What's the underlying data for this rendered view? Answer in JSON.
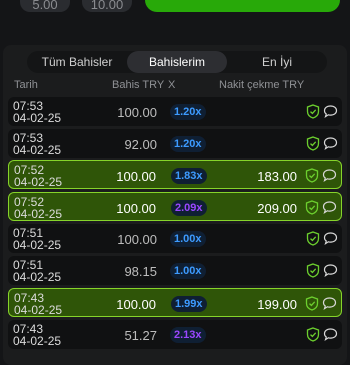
{
  "top": {
    "amounts": [
      "5.00",
      "10.00"
    ]
  },
  "tabs": [
    {
      "label": "Tüm Bahisler"
    },
    {
      "label": "Bahislerim"
    },
    {
      "label": "En İyi"
    }
  ],
  "columns": {
    "date": "Tarih",
    "bet": "Bahis TRY",
    "mult": "X",
    "cashout": "Nakit çekme TRY"
  },
  "colors": {
    "mult_blue": "#3d9bff",
    "mult_purple": "#9a47ff",
    "win_border": "#86d42a"
  },
  "rows": [
    {
      "time": "07:53",
      "date": "04-02-25",
      "bet": "100.00",
      "mult": "1.20x",
      "mult_color": "#3d9bff",
      "cashout": "",
      "win": false
    },
    {
      "time": "07:53",
      "date": "04-02-25",
      "bet": "92.00",
      "mult": "1.20x",
      "mult_color": "#3d9bff",
      "cashout": "",
      "win": false
    },
    {
      "time": "07:52",
      "date": "04-02-25",
      "bet": "100.00",
      "mult": "1.83x",
      "mult_color": "#3d9bff",
      "cashout": "183.00",
      "win": true
    },
    {
      "time": "07:52",
      "date": "04-02-25",
      "bet": "100.00",
      "mult": "2.09x",
      "mult_color": "#9a47ff",
      "cashout": "209.00",
      "win": true
    },
    {
      "time": "07:51",
      "date": "04-02-25",
      "bet": "100.00",
      "mult": "1.00x",
      "mult_color": "#3d9bff",
      "cashout": "",
      "win": false
    },
    {
      "time": "07:51",
      "date": "04-02-25",
      "bet": "98.15",
      "mult": "1.00x",
      "mult_color": "#3d9bff",
      "cashout": "",
      "win": false
    },
    {
      "time": "07:43",
      "date": "04-02-25",
      "bet": "100.00",
      "mult": "1.99x",
      "mult_color": "#3d9bff",
      "cashout": "199.00",
      "win": true
    },
    {
      "time": "07:43",
      "date": "04-02-25",
      "bet": "51.27",
      "mult": "2.13x",
      "mult_color": "#9a47ff",
      "cashout": "",
      "win": false
    }
  ]
}
